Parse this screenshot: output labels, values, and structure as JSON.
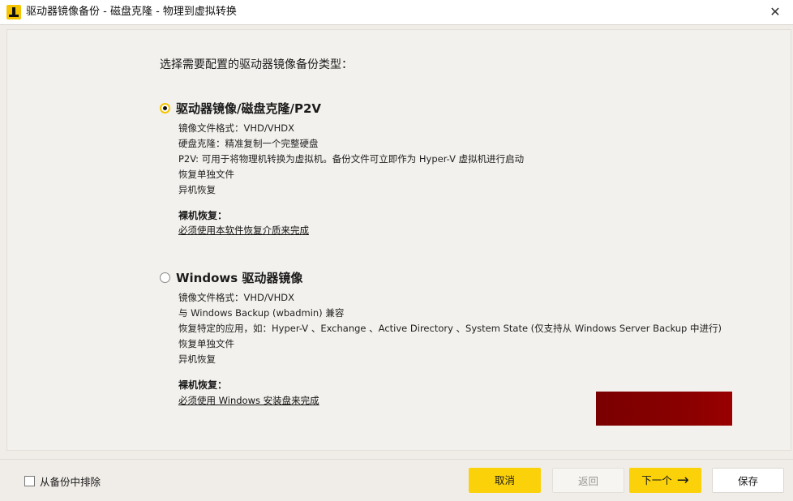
{
  "window": {
    "title": "驱动器镜像备份 - 磁盘克隆 - 物理到虚拟转换",
    "close_glyph": "✕"
  },
  "main": {
    "prompt": "选择需要配置的驱动器镜像备份类型：",
    "options": [
      {
        "title": "驱动器镜像/磁盘克隆/P2V",
        "selected": true,
        "lines": [
          "镜像文件格式：VHD/VHDX",
          "硬盘克隆：精准复制一个完整硬盘",
          "P2V: 可用于将物理机转换为虚拟机。备份文件可立即作为 Hyper-V 虚拟机进行启动",
          "恢复单独文件",
          "异机恢复"
        ],
        "bare_metal_title": "裸机恢复：",
        "bare_metal_link": "必须使用本软件恢复介质来完成"
      },
      {
        "title": "Windows 驱动器镜像",
        "selected": false,
        "lines": [
          "镜像文件格式：VHD/VHDX",
          "与 Windows Backup (wbadmin) 兼容",
          "恢复特定的应用，如：Hyper-V 、Exchange 、Active Directory 、System State (仅支持从 Windows Server Backup 中进行)",
          "恢复单独文件",
          "异机恢复"
        ],
        "bare_metal_title": "裸机恢复：",
        "bare_metal_link": "必须使用 Windows 安装盘来完成"
      }
    ]
  },
  "footer": {
    "exclude_label": "从备份中排除",
    "cancel_label": "取消",
    "back_label": "返回",
    "next_label": "下一个",
    "save_label": "保存"
  },
  "colors": {
    "accent": "#fbd20a",
    "redacted_block": "#8b0000"
  }
}
